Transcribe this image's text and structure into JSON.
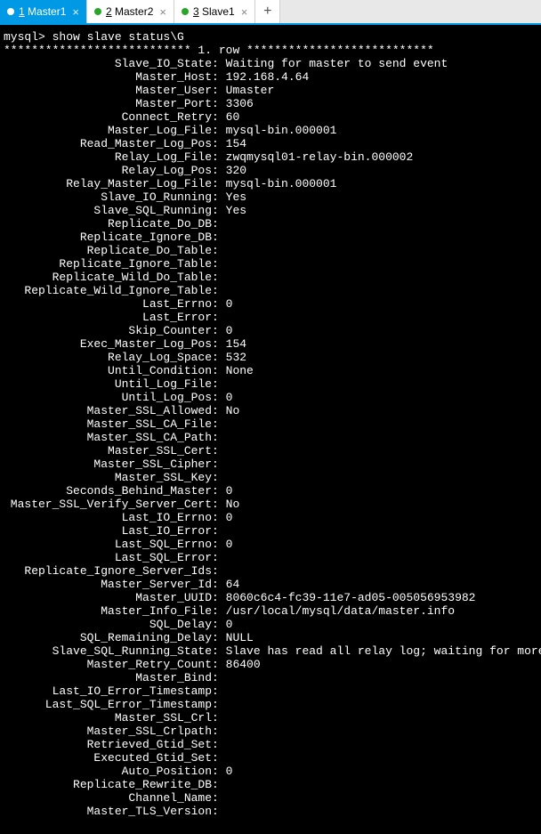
{
  "tabs": [
    {
      "num": "1",
      "name": "Master1",
      "active": true
    },
    {
      "num": "2",
      "name": "Master2",
      "active": false
    },
    {
      "num": "3",
      "name": "Slave1",
      "active": false
    }
  ],
  "prompt": "mysql> show slave status\\G",
  "row_sep_left": "*************************** 1. row ",
  "row_sep_right": "***************************",
  "label_width": 30,
  "status": [
    {
      "k": "Slave_IO_State",
      "v": "Waiting for master to send event"
    },
    {
      "k": "Master_Host",
      "v": "192.168.4.64"
    },
    {
      "k": "Master_User",
      "v": "Umaster"
    },
    {
      "k": "Master_Port",
      "v": "3306"
    },
    {
      "k": "Connect_Retry",
      "v": "60"
    },
    {
      "k": "Master_Log_File",
      "v": "mysql-bin.000001"
    },
    {
      "k": "Read_Master_Log_Pos",
      "v": "154"
    },
    {
      "k": "Relay_Log_File",
      "v": "zwqmysql01-relay-bin.000002"
    },
    {
      "k": "Relay_Log_Pos",
      "v": "320"
    },
    {
      "k": "Relay_Master_Log_File",
      "v": "mysql-bin.000001"
    },
    {
      "k": "Slave_IO_Running",
      "v": "Yes"
    },
    {
      "k": "Slave_SQL_Running",
      "v": "Yes"
    },
    {
      "k": "Replicate_Do_DB",
      "v": ""
    },
    {
      "k": "Replicate_Ignore_DB",
      "v": ""
    },
    {
      "k": "Replicate_Do_Table",
      "v": ""
    },
    {
      "k": "Replicate_Ignore_Table",
      "v": ""
    },
    {
      "k": "Replicate_Wild_Do_Table",
      "v": ""
    },
    {
      "k": "Replicate_Wild_Ignore_Table",
      "v": ""
    },
    {
      "k": "Last_Errno",
      "v": "0"
    },
    {
      "k": "Last_Error",
      "v": ""
    },
    {
      "k": "Skip_Counter",
      "v": "0"
    },
    {
      "k": "Exec_Master_Log_Pos",
      "v": "154"
    },
    {
      "k": "Relay_Log_Space",
      "v": "532"
    },
    {
      "k": "Until_Condition",
      "v": "None"
    },
    {
      "k": "Until_Log_File",
      "v": ""
    },
    {
      "k": "Until_Log_Pos",
      "v": "0"
    },
    {
      "k": "Master_SSL_Allowed",
      "v": "No"
    },
    {
      "k": "Master_SSL_CA_File",
      "v": ""
    },
    {
      "k": "Master_SSL_CA_Path",
      "v": ""
    },
    {
      "k": "Master_SSL_Cert",
      "v": ""
    },
    {
      "k": "Master_SSL_Cipher",
      "v": ""
    },
    {
      "k": "Master_SSL_Key",
      "v": ""
    },
    {
      "k": "Seconds_Behind_Master",
      "v": "0"
    },
    {
      "k": "Master_SSL_Verify_Server_Cert",
      "v": "No"
    },
    {
      "k": "Last_IO_Errno",
      "v": "0"
    },
    {
      "k": "Last_IO_Error",
      "v": ""
    },
    {
      "k": "Last_SQL_Errno",
      "v": "0"
    },
    {
      "k": "Last_SQL_Error",
      "v": ""
    },
    {
      "k": "Replicate_Ignore_Server_Ids",
      "v": ""
    },
    {
      "k": "Master_Server_Id",
      "v": "64"
    },
    {
      "k": "Master_UUID",
      "v": "8060c6c4-fc39-11e7-ad05-005056953982"
    },
    {
      "k": "Master_Info_File",
      "v": "/usr/local/mysql/data/master.info"
    },
    {
      "k": "SQL_Delay",
      "v": "0"
    },
    {
      "k": "SQL_Remaining_Delay",
      "v": "NULL"
    },
    {
      "k": "Slave_SQL_Running_State",
      "v": "Slave has read all relay log; waiting for more updates"
    },
    {
      "k": "Master_Retry_Count",
      "v": "86400"
    },
    {
      "k": "Master_Bind",
      "v": ""
    },
    {
      "k": "Last_IO_Error_Timestamp",
      "v": ""
    },
    {
      "k": "Last_SQL_Error_Timestamp",
      "v": ""
    },
    {
      "k": "Master_SSL_Crl",
      "v": ""
    },
    {
      "k": "Master_SSL_Crlpath",
      "v": ""
    },
    {
      "k": "Retrieved_Gtid_Set",
      "v": ""
    },
    {
      "k": "Executed_Gtid_Set",
      "v": ""
    },
    {
      "k": "Auto_Position",
      "v": "0"
    },
    {
      "k": "Replicate_Rewrite_DB",
      "v": ""
    },
    {
      "k": "Channel_Name",
      "v": ""
    },
    {
      "k": "Master_TLS_Version",
      "v": ""
    }
  ]
}
